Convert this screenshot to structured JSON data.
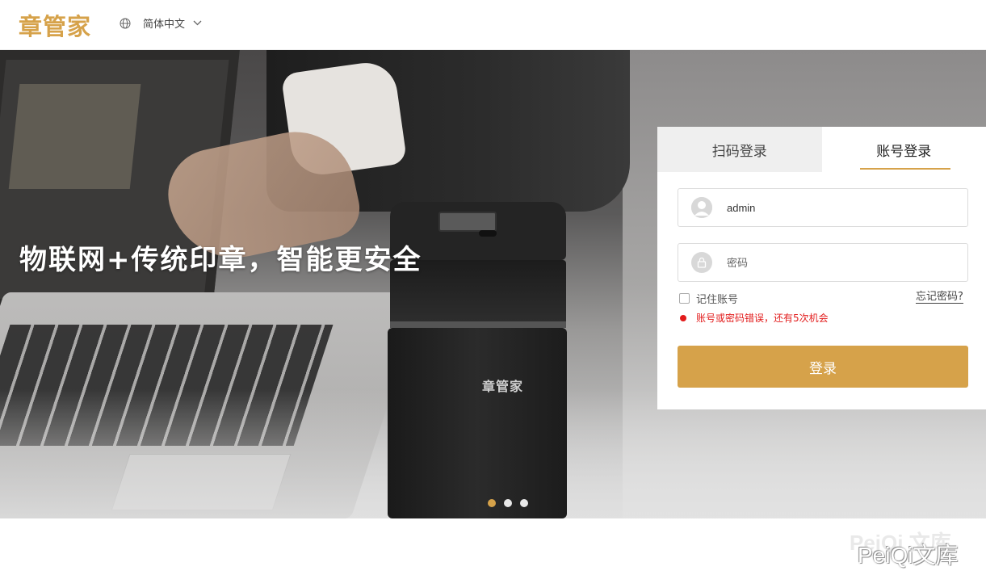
{
  "header": {
    "logo": "章管家",
    "language": "简体中文"
  },
  "banner": {
    "slogan": "物联网+传统印章，智能更安全",
    "device_logo": "章管家",
    "carousel_dots": 3,
    "active_dot": 1
  },
  "login": {
    "tabs": [
      {
        "label": "扫码登录",
        "active": false
      },
      {
        "label": "账号登录",
        "active": true
      }
    ],
    "username": {
      "value": "admin"
    },
    "password": {
      "placeholder": "密码",
      "value": ""
    },
    "remember_label": "记住账号",
    "remember_checked": false,
    "forgot_label": "忘记密码?",
    "error_message": "账号或密码错误，还有5次机会",
    "submit_label": "登录"
  },
  "watermark": {
    "text": "PeiQi文库",
    "ghost": "PeiQi 文库"
  },
  "colors": {
    "accent": "#d6a24a",
    "error": "#e21b1b",
    "tab_inactive_bg": "#efefef"
  }
}
